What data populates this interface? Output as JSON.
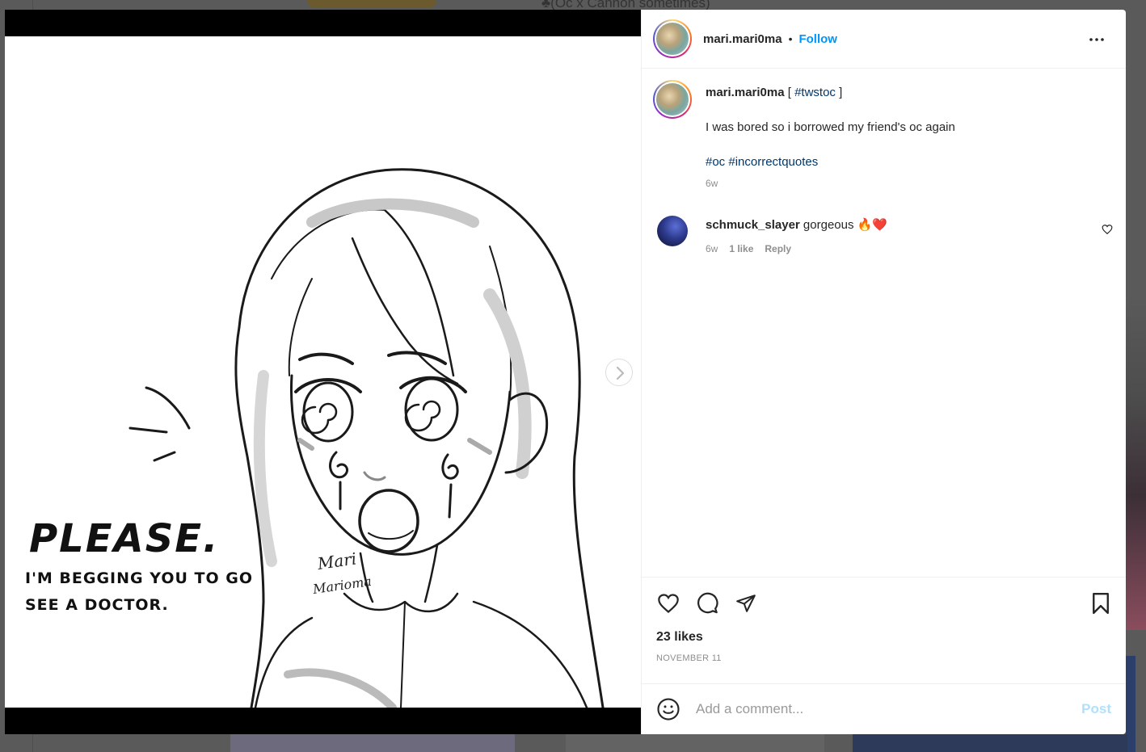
{
  "background": {
    "partial_text": "♣(Oc x Cannon sometimes)"
  },
  "post": {
    "username": "mari.mari0ma",
    "follow_label": "Follow",
    "separator": "•",
    "caption": {
      "username": "mari.mari0ma",
      "bracket_open": "[",
      "bracket_tag": "#twstoc",
      "bracket_close": "]",
      "text": "I was bored so i borrowed my friend's oc again",
      "tag1": "#oc",
      "tag2": "#incorrectquotes",
      "age": "6w"
    },
    "comments": [
      {
        "username": "schmuck_slayer",
        "text": "gorgeous 🔥❤️",
        "age": "6w",
        "likes": "1 like",
        "reply": "Reply"
      }
    ],
    "likes": "23 likes",
    "date": "NOVEMBER 11",
    "comment_placeholder": "Add a comment...",
    "post_label": "Post",
    "artwork": {
      "headline": "PLEASE.",
      "line1": "I'M BEGGING YOU TO GO",
      "line2": "SEE A DOCTOR.",
      "signature1": "Mari",
      "signature2": "Marioma"
    }
  },
  "icons": {
    "more": "more-options-icon",
    "like": "heart-icon",
    "comment": "comment-icon",
    "share": "share-icon",
    "save": "bookmark-icon",
    "emoji": "emoji-icon",
    "next": "chevron-right-icon"
  },
  "colors": {
    "follow": "#0095f6",
    "hashtag": "#00376b",
    "post_disabled": "#b2dffc",
    "meta": "#8e8e8e"
  }
}
